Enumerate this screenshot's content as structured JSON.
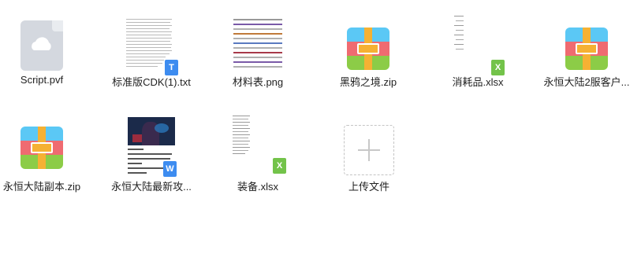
{
  "files": [
    {
      "name": "Script.pvf",
      "icon": "cloud-file-icon"
    },
    {
      "name": "标准版CDK(1).txt",
      "icon": "txt-file-icon",
      "badge": "T"
    },
    {
      "name": "材料表.png",
      "icon": "image-file-icon"
    },
    {
      "name": "黑鸦之境.zip",
      "icon": "zip-archive-icon"
    },
    {
      "name": "消耗品.xlsx",
      "icon": "excel-file-icon",
      "badge": "X"
    },
    {
      "name": "永恒大陆2服客户...",
      "icon": "zip-archive-icon"
    },
    {
      "name": "永恒大陆副本.zip",
      "icon": "zip-archive-icon"
    },
    {
      "name": "永恒大陆最新攻...",
      "icon": "word-file-icon",
      "badge": "W"
    },
    {
      "name": "装备.xlsx",
      "icon": "excel-file-icon",
      "badge": "X"
    }
  ],
  "upload": {
    "label": "上传文件",
    "icon": "plus-icon"
  },
  "colors": {
    "txt_badge": "#3d8cf0",
    "excel_badge": "#73c34a",
    "word_badge": "#3d8cf0"
  }
}
